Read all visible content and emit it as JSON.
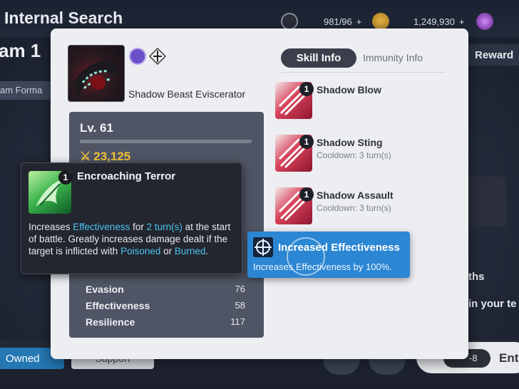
{
  "background": {
    "title": "Internal Search",
    "team_label": "am 1",
    "formation_label": "am Forma",
    "reward_label": "Reward",
    "resources": [
      {
        "icon": "stamina-icon",
        "value": "981/96"
      },
      {
        "icon": "gold-icon",
        "value": "1,249,930"
      },
      {
        "icon": "crystal-icon",
        "value": ""
      }
    ],
    "right_text_1": "ths",
    "right_text_2": "in your te",
    "owned_label": "Owned",
    "support_label": "Support",
    "enter_label": "Ente",
    "enter_cost": "-8"
  },
  "hero": {
    "name": "Shadow Beast Eviscerator",
    "level": "Lv. 61",
    "power": "23,125",
    "accent_gold": "#f2c23a"
  },
  "stats": [
    {
      "label": "Evasion",
      "value": "76"
    },
    {
      "label": "Effectiveness",
      "value": "58"
    },
    {
      "label": "Resilience",
      "value": "117"
    }
  ],
  "tabs": {
    "active": "Skill Info",
    "inactive": "Immunity Info"
  },
  "skills": [
    {
      "num": "1",
      "name": "Shadow Blow",
      "cooldown": ""
    },
    {
      "num": "1",
      "name": "Shadow Sting",
      "cooldown": "Cooldown: 3 turn(s)"
    },
    {
      "num": "1",
      "name": "Shadow Assault",
      "cooldown": "Cooldown: 3 turn(s)"
    }
  ],
  "tooltip_left": {
    "num": "1",
    "title": "Encroaching Terror",
    "desc_1": "Increases ",
    "desc_hl_1": "Effectiveness",
    "desc_2": " for ",
    "desc_hl_2": "2 turn(s)",
    "desc_3": " at the start of battle. Greatly increases damage dealt if the target is inflicted with ",
    "desc_hl_3": "Poisoned",
    "desc_4": " or ",
    "desc_hl_4": "Burned",
    "desc_5": ".",
    "highlight_color": "#4ac3f0"
  },
  "tooltip_right": {
    "title": "Increased Effectiveness",
    "desc": "Increases Effectiveness by 100%.",
    "color": "#2b86d3"
  }
}
